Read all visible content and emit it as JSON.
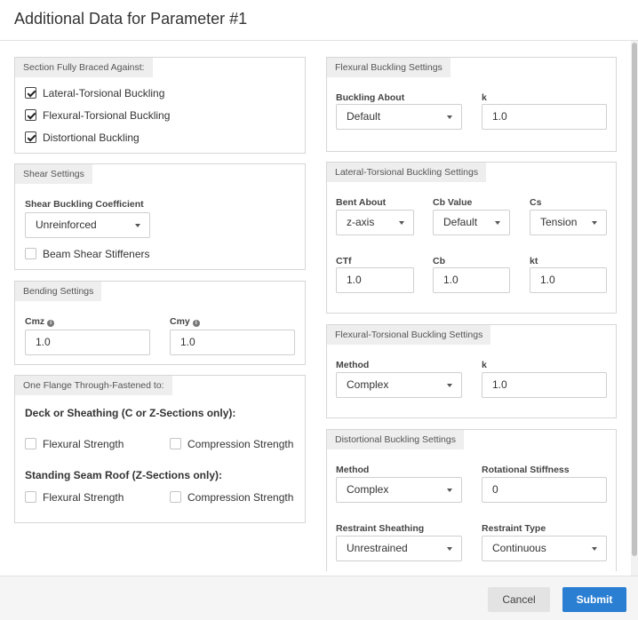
{
  "dialog": {
    "title": "Additional Data for Parameter #1"
  },
  "braced": {
    "title": "Section Fully Braced Against:",
    "items": [
      {
        "label": "Lateral-Torsional Buckling",
        "checked": true
      },
      {
        "label": "Flexural-Torsional Buckling",
        "checked": true
      },
      {
        "label": "Distortional Buckling",
        "checked": true
      }
    ]
  },
  "shear": {
    "title": "Shear Settings",
    "coef_label": "Shear Buckling Coefficient",
    "coef_value": "Unreinforced",
    "stiffeners_label": "Beam Shear Stiffeners",
    "stiffeners_checked": false
  },
  "bending": {
    "title": "Bending Settings",
    "cmz_label": "Cmz",
    "cmz_value": "1.0",
    "cmy_label": "Cmy",
    "cmy_value": "1.0",
    "info_icon": "i"
  },
  "flange": {
    "title": "One Flange Through-Fastened to:",
    "deck_heading": "Deck or Sheathing (C or Z-Sections only):",
    "deck_flexural": "Flexural Strength",
    "deck_compression": "Compression Strength",
    "seam_heading": "Standing Seam Roof (Z-Sections only):",
    "seam_flexural": "Flexural Strength",
    "seam_compression": "Compression Strength"
  },
  "flexural": {
    "title": "Flexural Buckling Settings",
    "about_label": "Buckling About",
    "about_value": "Default",
    "k_label": "k",
    "k_value": "1.0"
  },
  "ltb": {
    "title": "Lateral-Torsional Buckling Settings",
    "bent_label": "Bent About",
    "bent_value": "z-axis",
    "cbv_label": "Cb Value",
    "cbv_value": "Default",
    "cs_label": "Cs",
    "cs_value": "Tension",
    "ctf_label": "CTf",
    "ctf_value": "1.0",
    "cb_label": "Cb",
    "cb_value": "1.0",
    "kt_label": "kt",
    "kt_value": "1.0"
  },
  "ftb": {
    "title": "Flexural-Torsional Buckling Settings",
    "method_label": "Method",
    "method_value": "Complex",
    "k_label": "k",
    "k_value": "1.0"
  },
  "distortional": {
    "title": "Distortional Buckling Settings",
    "method_label": "Method",
    "method_value": "Complex",
    "rot_label": "Rotational Stiffness",
    "rot_value": "0",
    "sheathing_label": "Restraint Sheathing",
    "sheathing_value": "Unrestrained",
    "type_label": "Restraint Type",
    "type_value": "Continuous"
  },
  "footer": {
    "cancel": "Cancel",
    "submit": "Submit"
  },
  "colors": {
    "primary": "#2b7fd3",
    "panel_header": "#eeeeee",
    "border": "#d6d6d6"
  }
}
